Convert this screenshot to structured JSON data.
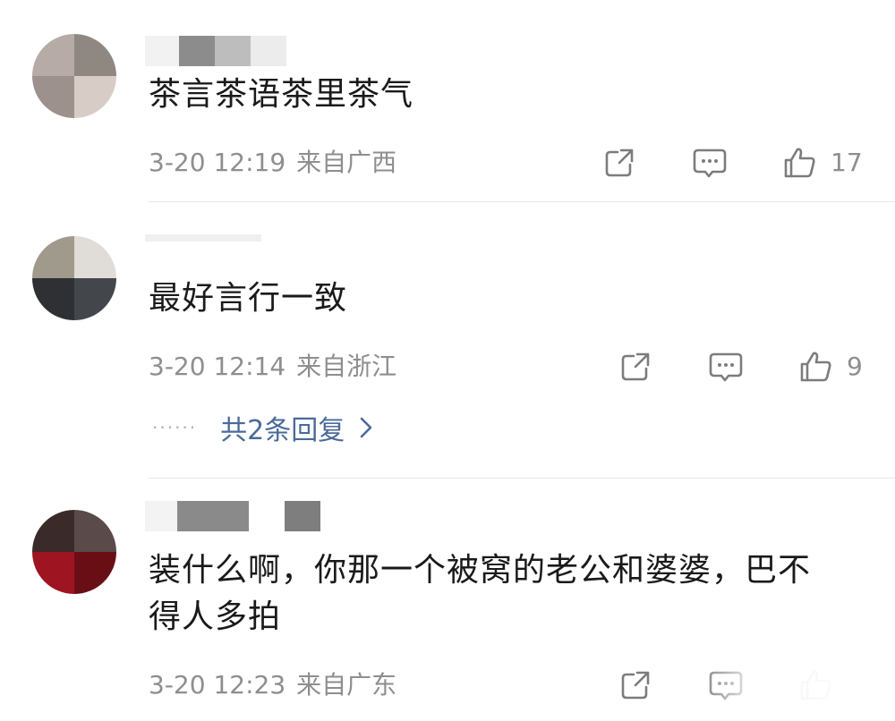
{
  "comments": [
    {
      "content": "茶言茶语茶里茶气",
      "time": "3-20 12:19",
      "location": "来自广西",
      "likes": "17",
      "avatar_colors": [
        "#b6aba7",
        "#8f8782",
        "#9c918d",
        "#d8ccc6"
      ]
    },
    {
      "content": "最好言行一致",
      "time": "3-20 12:14",
      "location": "来自浙江",
      "likes": "9",
      "replies_label": "共2条回复",
      "replies_dots": "······",
      "avatar_colors": [
        "#a09a8c",
        "#e0ddd8",
        "#2e3033",
        "#43464a"
      ]
    },
    {
      "content": "装什么啊，你那一个被窝的老公和婆婆，巴不得人多拍",
      "time": "3-20 12:23",
      "location": "来自广东",
      "avatar_colors": [
        "#3a2a2a",
        "#5a4a4a",
        "#9e1420",
        "#6a0e16"
      ]
    }
  ],
  "colors": {
    "meta_text": "#8e8e8e",
    "reply_link": "#4a6a9a",
    "icon_stroke": "#7c7c7c",
    "divider": "#e6e6e6"
  }
}
